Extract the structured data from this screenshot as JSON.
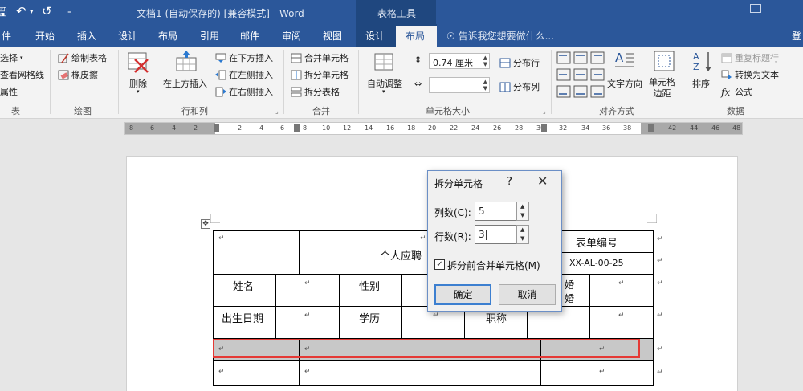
{
  "window": {
    "title": "文档1 (自动保存的) [兼容模式] - Word",
    "context_label": "表格工具"
  },
  "tabs": [
    "件",
    "开始",
    "插入",
    "设计",
    "布局",
    "引用",
    "邮件",
    "审阅",
    "视图",
    "设计",
    "布局"
  ],
  "active_tab": "布局",
  "tell_me": "告诉我您想要做什么...",
  "signin": "登",
  "ribbon": {
    "table_group": {
      "items": [
        "选择",
        "查看网格线",
        "属性"
      ],
      "label": "表"
    },
    "draw_group": {
      "items": [
        "绘制表格",
        "橡皮擦"
      ],
      "label": "绘图"
    },
    "rowcol_group": {
      "delete": "删除",
      "insert_above": "在上方插入",
      "insert_below": "在下方插入",
      "insert_left": "在左侧插入",
      "insert_right": "在右侧插入",
      "label": "行和列"
    },
    "merge_group": {
      "items": [
        "合并单元格",
        "拆分单元格",
        "拆分表格"
      ],
      "label": "合并"
    },
    "cellsize_group": {
      "autofit": "自动调整",
      "height_value": "0.74 厘米",
      "width_value": "",
      "distribute_rows": "分布行",
      "distribute_cols": "分布列",
      "label": "单元格大小"
    },
    "align_group": {
      "text_direction": "文字方向",
      "cell_margins": "单元格\n边距",
      "label": "对齐方式"
    },
    "data_group": {
      "sort": "排序",
      "repeat_header": "重复标题行",
      "convert_to_text": "转换为文本",
      "formula": "公式",
      "label": "数据"
    }
  },
  "ruler": {
    "labels": [
      "8",
      "6",
      "4",
      "2",
      "2",
      "4",
      "6",
      "8",
      "10",
      "12",
      "14",
      "16",
      "18",
      "20",
      "22",
      "24",
      "26",
      "28",
      "30",
      "32",
      "34",
      "36",
      "38",
      "42",
      "44",
      "46",
      "48"
    ]
  },
  "table": {
    "title_partial": "个人应聘",
    "form_no_label": "表单编号",
    "form_no_value": "XX-AL-00-25",
    "name_label": "姓名",
    "gender_label": "性别",
    "marital_top": "婚",
    "marital_bottom": "婚",
    "birth_label": "出生日期",
    "education_label": "学历",
    "title_label_partial": "职称"
  },
  "dialog": {
    "title": "拆分单元格",
    "help": "?",
    "close": "✕",
    "columns_label": "列数(C):",
    "columns_value": "5",
    "rows_label": "行数(R):",
    "rows_value": "3",
    "merge_before_split_label": "拆分前合并单元格(M)",
    "merge_before_split_checked": true,
    "ok_label": "确定",
    "cancel_label": "取消"
  },
  "colors": {
    "word_blue": "#2b579a",
    "context_blue": "#1f477f",
    "highlight_red": "#e53935",
    "selection_gray": "#c8c8c8"
  }
}
